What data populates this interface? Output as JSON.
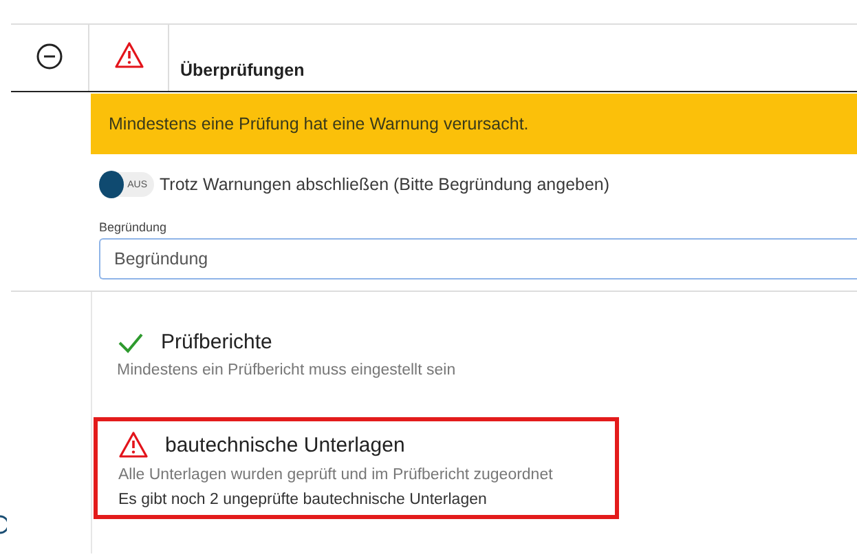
{
  "header": {
    "title": "Überprüfungen"
  },
  "banner": {
    "text": "Mindestens eine Prüfung hat eine Warnung verursacht."
  },
  "toggle": {
    "on": false,
    "state_label": "AUS",
    "label": "Trotz Warnungen abschließen (Bitte Begründung angeben)"
  },
  "reason_field": {
    "label": "Begründung",
    "placeholder": "Begründung"
  },
  "checks": [
    {
      "kind": "passed",
      "title": "Prüfberichte",
      "highlighted": false,
      "messages": [
        "Mindestens ein Prüfbericht muss eingestellt sein"
      ]
    },
    {
      "kind": "warning",
      "title": "bautechnische Unterlagen",
      "highlighted": true,
      "messages": [
        "Alle Unterlagen wurden geprüft und im Prüfbericht zugeordnet",
        "Es gibt noch 2 ungeprüfte bautechnische Unterlagen"
      ]
    }
  ]
}
